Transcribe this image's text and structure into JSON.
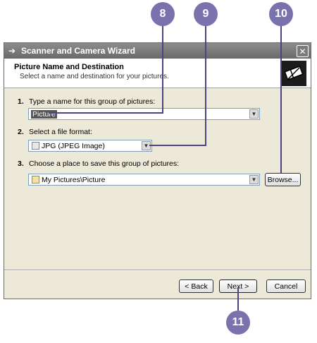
{
  "callouts": [
    "8",
    "9",
    "10",
    "11"
  ],
  "window": {
    "title": "Scanner and Camera Wizard",
    "close_glyph": "✕"
  },
  "header": {
    "title": "Picture Name and Destination",
    "subtitle": "Select a name and destination for your pictures."
  },
  "steps": [
    {
      "num": "1.",
      "label": "Type a name for this group of pictures:"
    },
    {
      "num": "2.",
      "label": "Select a file format:"
    },
    {
      "num": "3.",
      "label": "Choose a place to save this group of pictures:"
    }
  ],
  "name_field": {
    "value": "Picture"
  },
  "format_field": {
    "value": "JPG (JPEG Image)",
    "icon": "image-file-icon"
  },
  "destination_field": {
    "value": "My Pictures\\Picture",
    "icon": "folder-icon"
  },
  "buttons": {
    "browse": "Browse...",
    "back": "< Back",
    "next": "Next >",
    "cancel": "Cancel"
  },
  "colors": {
    "callout": "#7a72ad",
    "titlebar": "#7a7a7a",
    "dialog_bg": "#ece9d8"
  }
}
